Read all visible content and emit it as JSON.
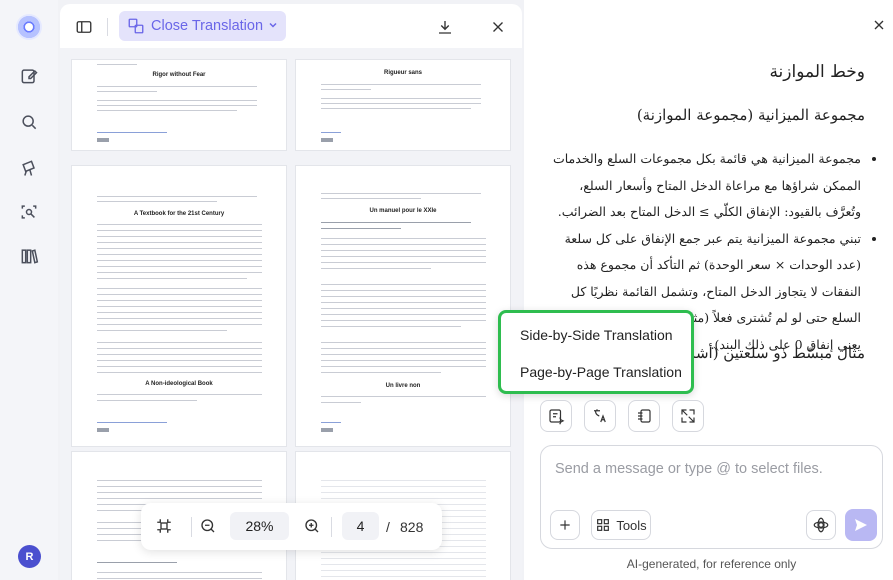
{
  "toolbar": {
    "close_translation_label": "Close Translation"
  },
  "zoom": {
    "level": "28%",
    "page_current": "4",
    "page_separator": "/",
    "page_total": "828"
  },
  "thumbnails": {
    "p1_title": "Rigor without Fear",
    "p2_title": "Rigueur sans",
    "p3_title": "A Textbook for the 21st Century",
    "p3_subtitle": "A Non-ideological Book",
    "p4_title": "Un manuel pour le XXIe",
    "p4_subtitle": "Un livre non"
  },
  "translation": {
    "heading": "وخط الموازنة",
    "subheading": "مجموعة الميزانية (مجموعة الموازنة)",
    "bullets": [
      "مجموعة الميزانية هي قائمة بكل مجموعات السلع والخدمات الممكن شراؤها مع مراعاة الدخل المتاح وأسعار السلع، وتُعرَّف بالقيود: الإنفاق الكلّي ≥ الدخل المتاح بعد الضرائب.",
      "تبني مجموعة الميزانية يتم عبر جمع الإنفاق على كل سلعة (عدد الوحدات × سعر الوحدة) ثم التأكد أن مجموع هذه النفقات لا يتجاوز الدخل المتاح، وتشمل القائمة نظريًا كل السلع حتى لو لم تُشترى فعلاً (مثال: شراء 0 سيارة فارهة يعني إنفاق 0 على ذلك البند)."
    ],
    "heading2": "مثال مبسّط ذو سلعتين (أشرطة السو"
  },
  "popup": {
    "option1": "Side-by-Side Translation",
    "option2": "Page-by-Page Translation"
  },
  "chat": {
    "placeholder": "Send a message or type @ to select files.",
    "tools_label": "Tools",
    "footnote": "AI-generated, for reference only"
  },
  "user": {
    "avatar_initial": "R"
  },
  "colors": {
    "accent": "#6a66e8",
    "accent_bg": "#e4e3fb",
    "highlight": "#2ebd4f",
    "avatar": "#4a4fcf"
  }
}
